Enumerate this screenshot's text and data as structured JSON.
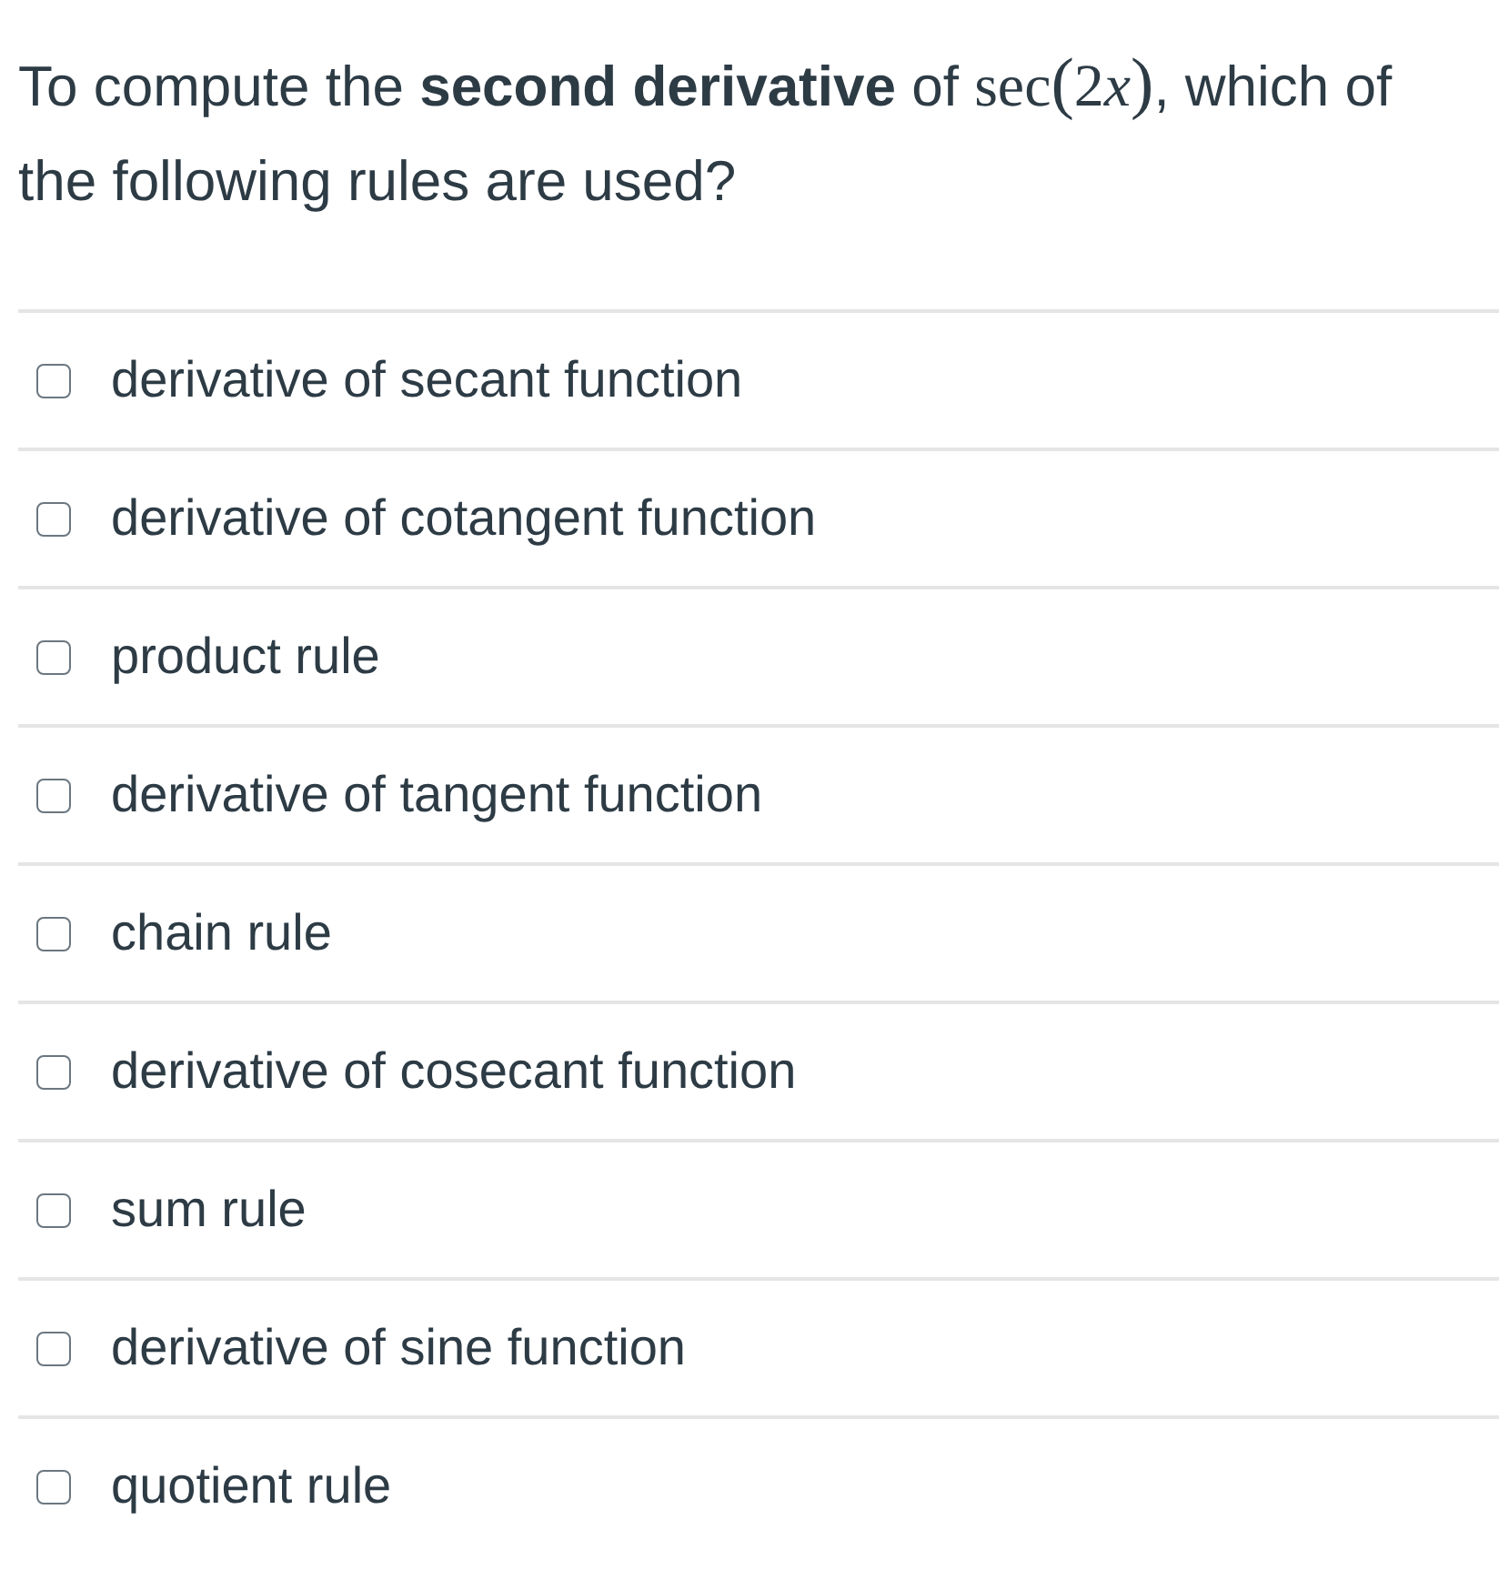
{
  "question": {
    "parts": [
      {
        "kind": "text",
        "text": "To compute the **second derivative** of "
      },
      {
        "kind": "math",
        "tokens": [
          {
            "kind": "upright",
            "text": "sec"
          },
          {
            "kind": "paren",
            "text": "("
          },
          {
            "kind": "upright",
            "text": "2"
          },
          {
            "kind": "variable",
            "text": "x"
          },
          {
            "kind": "paren",
            "text": ")"
          }
        ]
      },
      {
        "kind": "text",
        "text": ", which of the following rules are used?"
      }
    ]
  },
  "options": [
    {
      "label": "derivative of secant function",
      "checked": false
    },
    {
      "label": "derivative of cotangent function",
      "checked": false
    },
    {
      "label": "product rule",
      "checked": false
    },
    {
      "label": "derivative of tangent function",
      "checked": false
    },
    {
      "label": "chain rule",
      "checked": false
    },
    {
      "label": "derivative of cosecant function",
      "checked": false
    },
    {
      "label": "sum rule",
      "checked": false
    },
    {
      "label": "derivative of sine function",
      "checked": false
    },
    {
      "label": "quotient rule",
      "checked": false
    }
  ]
}
